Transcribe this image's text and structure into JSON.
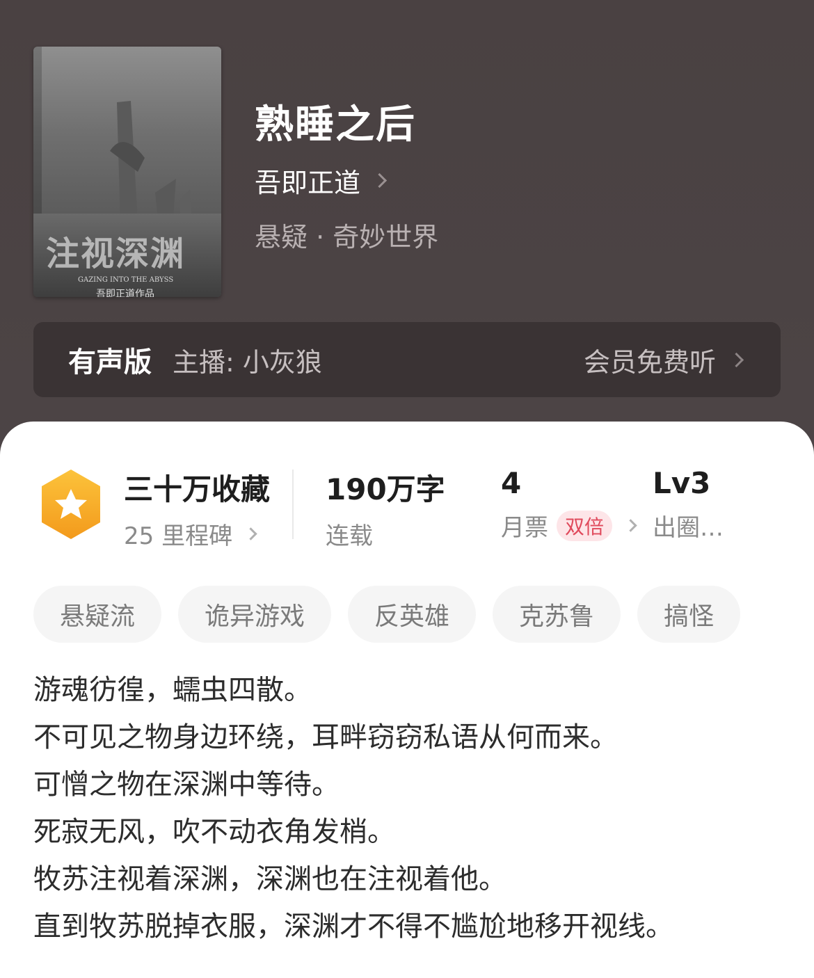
{
  "book": {
    "title": "熟睡之后",
    "author": "吾即正道",
    "genre": "悬疑 · 奇妙世界",
    "cover": {
      "title_text": "注视深渊",
      "subtitle_text": "GAZING INTO THE ABYSS",
      "author_text": "吾即正道作品"
    }
  },
  "audio": {
    "label": "有声版",
    "host": "主播: 小灰狼",
    "link": "会员免费听"
  },
  "stats": {
    "favorites": "三十万收藏",
    "milestones": "25 里程碑",
    "words": "190万字",
    "status": "连载",
    "monthly_votes": "4",
    "monthly_label": "月票",
    "double_badge": "双倍",
    "level": "Lv3",
    "level_label": "出圈…"
  },
  "tags": [
    "悬疑流",
    "诡异游戏",
    "反英雄",
    "克苏鲁",
    "搞怪"
  ],
  "description": [
    "游魂彷徨，蠕虫四散。",
    "不可见之物身边环绕，耳畔窃窃私语从何而来。",
    "可憎之物在深渊中等待。",
    "死寂无风，吹不动衣角发梢。",
    "牧苏注视着深渊，深渊也在注视着他。",
    "直到牧苏脱掉衣服，深渊才不得不尴尬地移开视线。"
  ],
  "colors": {
    "header_bg": "#4a4243",
    "audio_bar_bg": "#3a3334",
    "badge_orange": "#f6a623",
    "double_badge_bg": "#fde5e8",
    "double_badge_text": "#e04a5c"
  }
}
